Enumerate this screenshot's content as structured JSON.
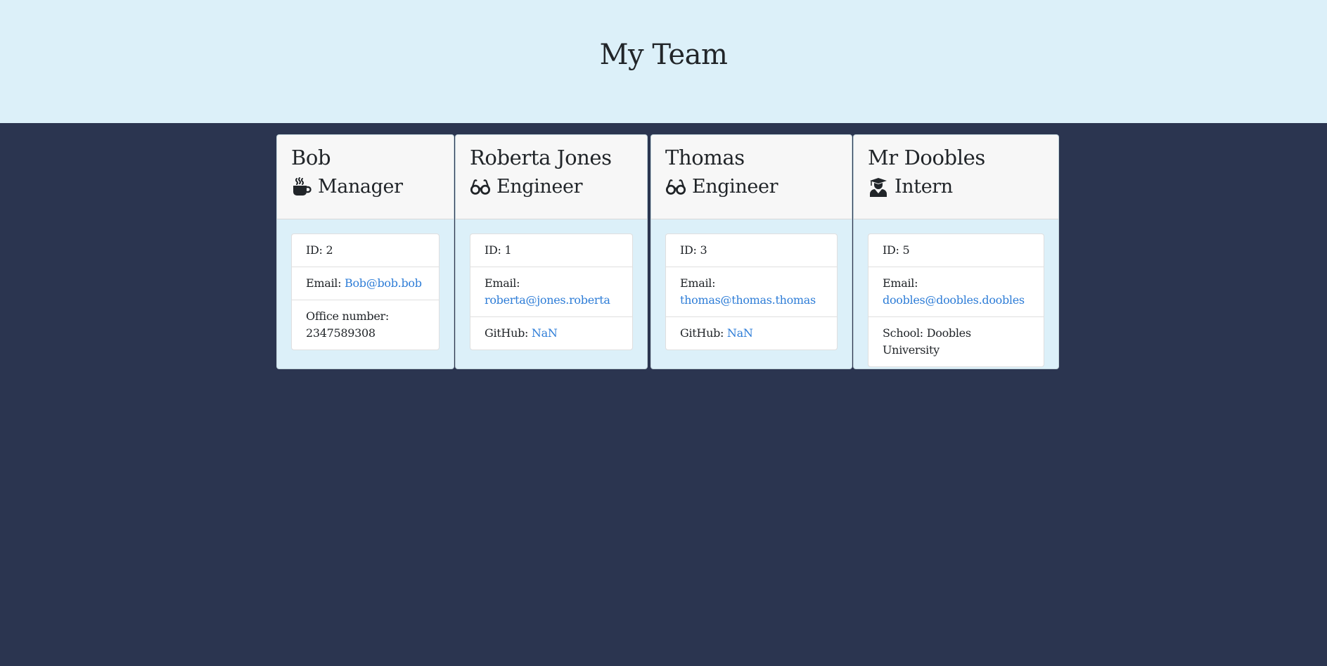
{
  "header": {
    "title": "My Team"
  },
  "team": [
    {
      "name": "Bob",
      "role": "Manager",
      "role_icon": "coffee-mug-icon",
      "id_label": "ID:",
      "id": "2",
      "email_label": "Email:",
      "email": "Bob@bob.bob",
      "extra_label": "Office number:",
      "extra_value": "2347589308"
    },
    {
      "name": "Roberta Jones",
      "role": "Engineer",
      "role_icon": "glasses-icon",
      "id_label": "ID:",
      "id": "1",
      "email_label": "Email:",
      "email": "roberta@jones.roberta",
      "extra_label": "GitHub:",
      "extra_value": "NaN"
    },
    {
      "name": "Thomas",
      "role": "Engineer",
      "role_icon": "glasses-icon",
      "id_label": "ID:",
      "id": "3",
      "email_label": "Email:",
      "email": "thomas@thomas.thomas",
      "extra_label": "GitHub:",
      "extra_value": "NaN"
    },
    {
      "name": "Mr Doobles",
      "role": "Intern",
      "role_icon": "graduate-icon",
      "id_label": "ID:",
      "id": "5",
      "email_label": "Email:",
      "email": "doobles@doobles.doobles",
      "extra_label": "School:",
      "extra_value": "Doobles University"
    }
  ],
  "colors": {
    "page_background": "#2b3550",
    "header_background": "#dcf0f9",
    "card_body_background": "#dcf0f9",
    "card_header_background": "#f7f7f7",
    "link": "#2e7dd7"
  }
}
